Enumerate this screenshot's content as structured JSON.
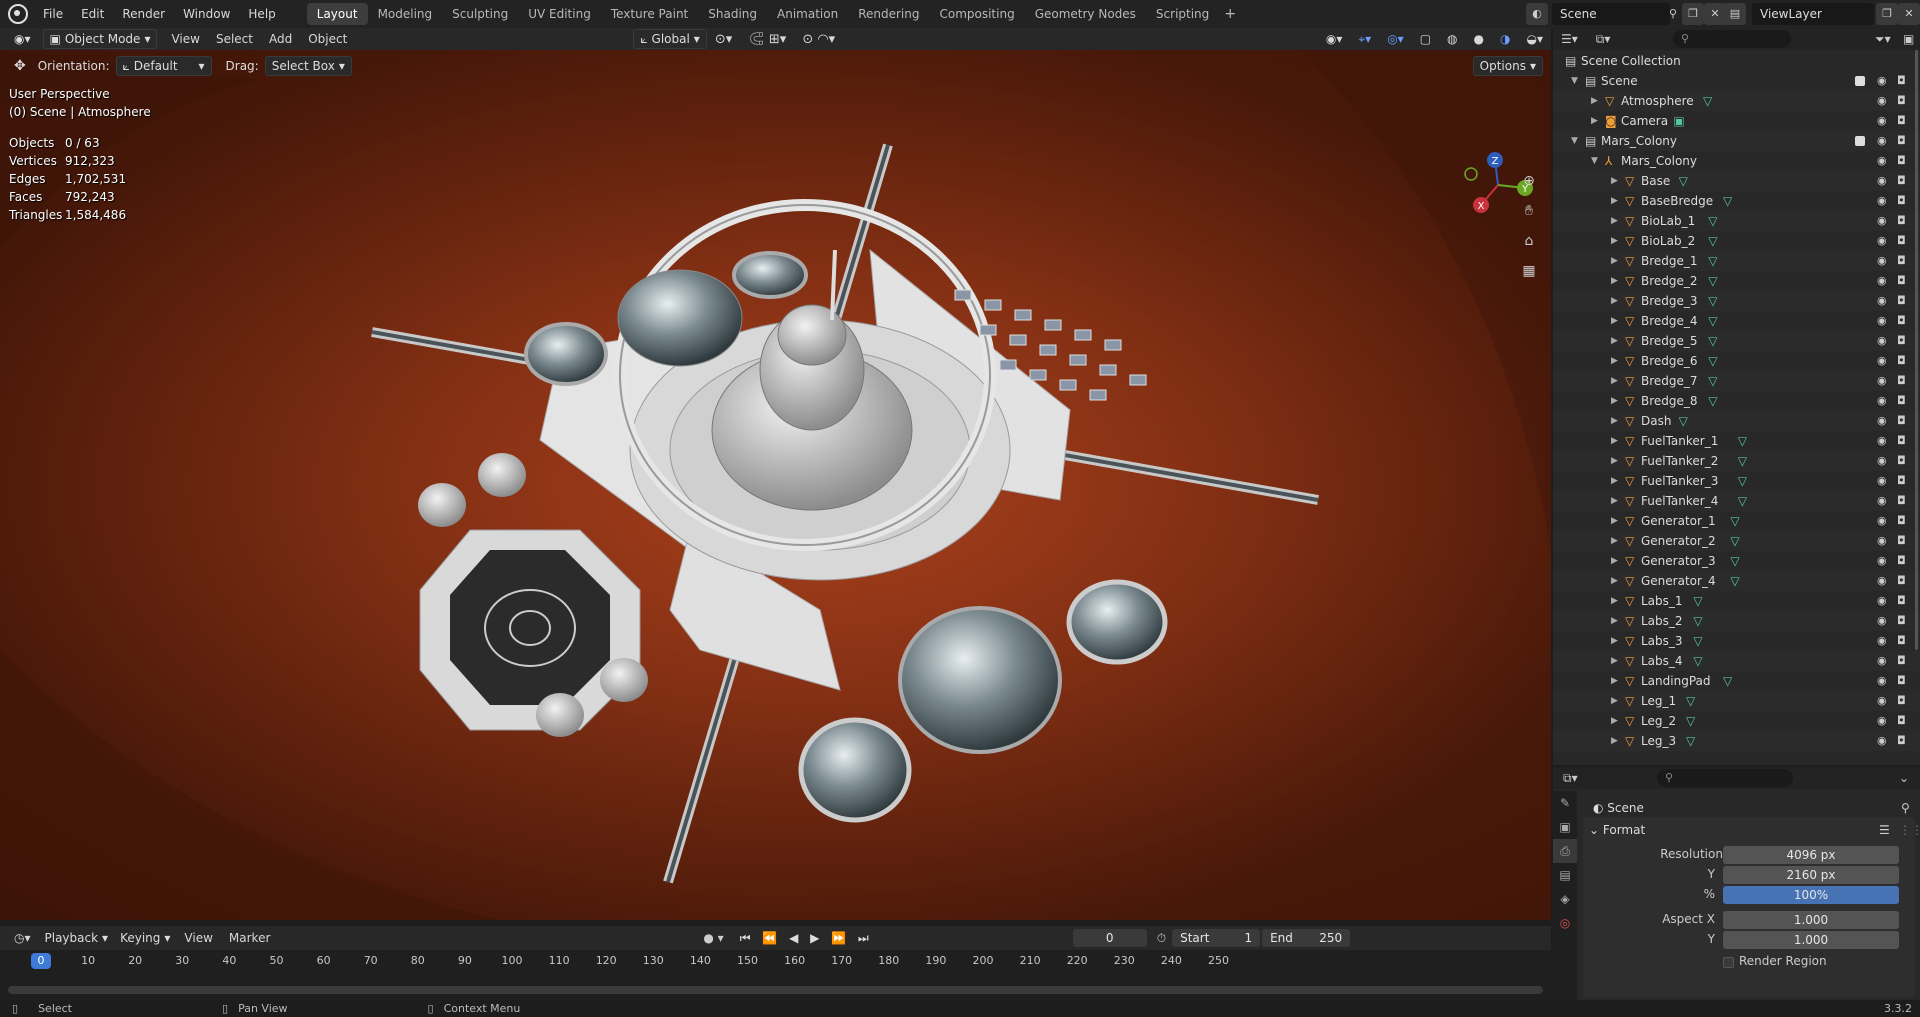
{
  "top_menu": [
    "File",
    "Edit",
    "Render",
    "Window",
    "Help"
  ],
  "workspaces": [
    "Layout",
    "Modeling",
    "Sculpting",
    "UV Editing",
    "Texture Paint",
    "Shading",
    "Animation",
    "Rendering",
    "Compositing",
    "Geometry Nodes",
    "Scripting"
  ],
  "active_workspace": "Layout",
  "scene_name": "Scene",
  "view_layer": "ViewLayer",
  "viewport_header": {
    "mode": "Object Mode",
    "menus": [
      "View",
      "Select",
      "Add",
      "Object"
    ],
    "transform": "Global"
  },
  "tool_settings": {
    "orientation_label": "Orientation:",
    "orientation": "Default",
    "drag_label": "Drag:",
    "drag": "Select Box",
    "options": "Options"
  },
  "viewport": {
    "perspective": "User Perspective",
    "context": "(0) Scene | Atmosphere",
    "stats": [
      {
        "label": "Objects",
        "value": "0 / 63"
      },
      {
        "label": "Vertices",
        "value": "912,323"
      },
      {
        "label": "Edges",
        "value": "1,702,531"
      },
      {
        "label": "Faces",
        "value": "792,243"
      },
      {
        "label": "Triangles",
        "value": "1,584,486"
      }
    ],
    "gizmo": {
      "x": "X",
      "y": "Y",
      "z": "Z"
    }
  },
  "timeline": {
    "menus": [
      "Playback",
      "Keying",
      "View",
      "Marker"
    ],
    "current_frame": "0",
    "start_label": "Start",
    "start": "1",
    "end_label": "End",
    "end": "250",
    "ticks": [
      "0",
      "10",
      "20",
      "30",
      "40",
      "50",
      "60",
      "70",
      "80",
      "90",
      "100",
      "110",
      "120",
      "130",
      "140",
      "150",
      "160",
      "170",
      "180",
      "190",
      "200",
      "210",
      "220",
      "230",
      "240",
      "250"
    ]
  },
  "statusbar": {
    "select": "Select",
    "pan": "Pan View",
    "context": "Context Menu",
    "version": "3.3.2"
  },
  "outliner": {
    "root": "Scene Collection",
    "rows": [
      {
        "label": "Scene",
        "depth": 0,
        "kind": "collection",
        "expanded": true
      },
      {
        "label": "Atmosphere",
        "depth": 1,
        "kind": "object-mesh"
      },
      {
        "label": "Camera",
        "depth": 1,
        "kind": "object-camera"
      },
      {
        "label": "Mars_Colony",
        "depth": 0,
        "kind": "collection",
        "expanded": true
      },
      {
        "label": "Mars_Colony",
        "depth": 1,
        "kind": "armature",
        "expanded": true
      },
      {
        "label": "Base",
        "depth": 2,
        "kind": "object-mesh"
      },
      {
        "label": "BaseBredge",
        "depth": 2,
        "kind": "object-mesh"
      },
      {
        "label": "BioLab_1",
        "depth": 2,
        "kind": "object-mesh"
      },
      {
        "label": "BioLab_2",
        "depth": 2,
        "kind": "object-mesh"
      },
      {
        "label": "Bredge_1",
        "depth": 2,
        "kind": "object-mesh"
      },
      {
        "label": "Bredge_2",
        "depth": 2,
        "kind": "object-mesh"
      },
      {
        "label": "Bredge_3",
        "depth": 2,
        "kind": "object-mesh"
      },
      {
        "label": "Bredge_4",
        "depth": 2,
        "kind": "object-mesh"
      },
      {
        "label": "Bredge_5",
        "depth": 2,
        "kind": "object-mesh"
      },
      {
        "label": "Bredge_6",
        "depth": 2,
        "kind": "object-mesh"
      },
      {
        "label": "Bredge_7",
        "depth": 2,
        "kind": "object-mesh"
      },
      {
        "label": "Bredge_8",
        "depth": 2,
        "kind": "object-mesh"
      },
      {
        "label": "Dash",
        "depth": 2,
        "kind": "object-mesh"
      },
      {
        "label": "FuelTanker_1",
        "depth": 2,
        "kind": "object-mesh"
      },
      {
        "label": "FuelTanker_2",
        "depth": 2,
        "kind": "object-mesh"
      },
      {
        "label": "FuelTanker_3",
        "depth": 2,
        "kind": "object-mesh"
      },
      {
        "label": "FuelTanker_4",
        "depth": 2,
        "kind": "object-mesh"
      },
      {
        "label": "Generator_1",
        "depth": 2,
        "kind": "object-mesh"
      },
      {
        "label": "Generator_2",
        "depth": 2,
        "kind": "object-mesh"
      },
      {
        "label": "Generator_3",
        "depth": 2,
        "kind": "object-mesh"
      },
      {
        "label": "Generator_4",
        "depth": 2,
        "kind": "object-mesh"
      },
      {
        "label": "Labs_1",
        "depth": 2,
        "kind": "object-mesh"
      },
      {
        "label": "Labs_2",
        "depth": 2,
        "kind": "object-mesh"
      },
      {
        "label": "Labs_3",
        "depth": 2,
        "kind": "object-mesh"
      },
      {
        "label": "Labs_4",
        "depth": 2,
        "kind": "object-mesh"
      },
      {
        "label": "LandingPad",
        "depth": 2,
        "kind": "object-mesh"
      },
      {
        "label": "Leg_1",
        "depth": 2,
        "kind": "object-mesh"
      },
      {
        "label": "Leg_2",
        "depth": 2,
        "kind": "object-mesh"
      },
      {
        "label": "Leg_3",
        "depth": 2,
        "kind": "object-mesh"
      }
    ]
  },
  "properties": {
    "context": "Scene",
    "panel": "Format",
    "resolution_x_label": "Resolution X",
    "resolution_x": "4096 px",
    "resolution_y_label": "Y",
    "resolution_y": "2160 px",
    "percent_label": "%",
    "percent": "100%",
    "aspect_x_label": "Aspect X",
    "aspect_x": "1.000",
    "aspect_y_label": "Y",
    "aspect_y": "1.000",
    "render_region": "Render Region"
  },
  "colors": {
    "accent": "#4772b3",
    "mesh": "#56c79a",
    "object": "#f09e3a",
    "terrain": "#8c3316"
  }
}
